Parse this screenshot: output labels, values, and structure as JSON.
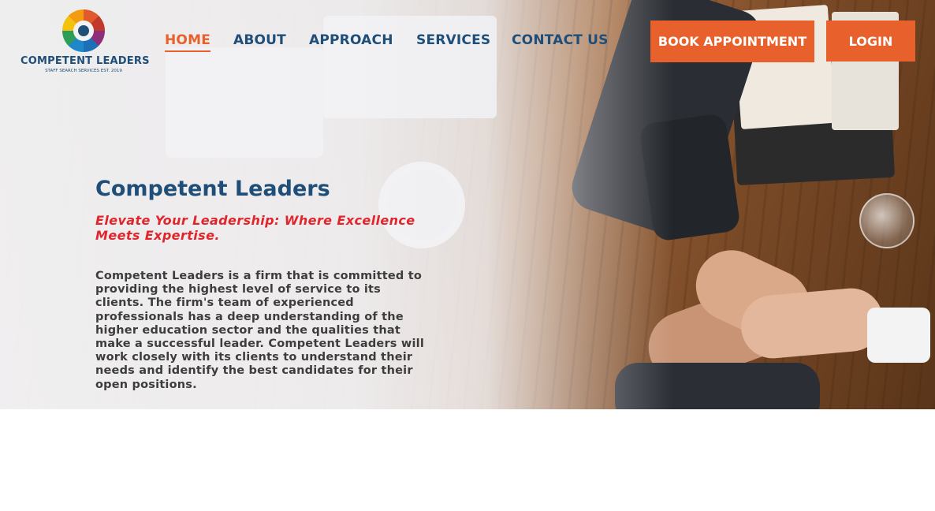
{
  "brand": {
    "name": "COMPETENT LEADERS",
    "tagline": "STAFF SEARCH SERVICES EST. 2019",
    "logo_icon": "multicolor-ring-logo"
  },
  "nav": {
    "items": [
      {
        "label": "HOME",
        "active": true
      },
      {
        "label": "ABOUT",
        "active": false
      },
      {
        "label": "APPROACH",
        "active": false
      },
      {
        "label": "SERVICES",
        "active": false
      },
      {
        "label": "CONTACT US",
        "active": false
      }
    ]
  },
  "actions": {
    "book_label": "BOOK APPOINTMENT",
    "login_label": "LOGIN"
  },
  "hero": {
    "title": "Competent Leaders",
    "tagline": "Elevate Your Leadership: Where Excellence Meets Expertise.",
    "body": "Competent Leaders is a firm that is committed to providing the highest level of service to its clients. The firm's team of experienced professionals has a deep understanding of the higher education sector and the qualities that make a successful leader. Competent Leaders will work closely with its clients to understand their needs and identify the best candidates for their open positions."
  },
  "colors": {
    "primary": "#1f4e79",
    "accent": "#e8612c",
    "tagline": "#e0262c",
    "body_text": "#3d3d3d"
  }
}
